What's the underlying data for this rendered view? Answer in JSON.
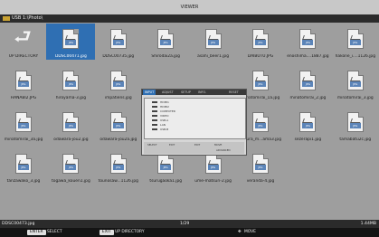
{
  "window": {
    "title": "VIEWER"
  },
  "path": {
    "text": "USB 1:\\Photo\\"
  },
  "files": [
    {
      "name": "UP DIRECTORY",
      "type": "updir"
    },
    {
      "name": "DDSC00471.jpg",
      "type": "image",
      "selected": true
    },
    {
      "name": "DDSC00735.jpg",
      "type": "image"
    },
    {
      "name": "Shirodai2a.jpg",
      "type": "image"
    },
    {
      "name": "asahi_beer1.jpg",
      "type": "image"
    },
    {
      "name": "DAIBUTU.JPG",
      "type": "image"
    },
    {
      "name": "enoshima....1887.jpg",
      "type": "image"
    },
    {
      "name": "hakone_i....1126.jpg",
      "type": "image"
    },
    {
      "name": "HANABI2.JPG",
      "type": "image"
    },
    {
      "name": "hiroyama-3.jpg",
      "type": "image"
    },
    {
      "name": "impatiens.jpg",
      "type": "image"
    },
    {
      "name": "",
      "type": "image",
      "hidden": true
    },
    {
      "name": "",
      "type": "image",
      "hidden": true
    },
    {
      "name": "minatomirai_1a.jpg",
      "type": "image"
    },
    {
      "name": "minatomirai_2.jpg",
      "type": "image"
    },
    {
      "name": "minatomirai_3.jpg",
      "type": "image"
    },
    {
      "name": "minatomirai_3a.jpg",
      "type": "image"
    },
    {
      "name": "odawara-jou2.jpg",
      "type": "image"
    },
    {
      "name": "odawara-jou2a.jpg",
      "type": "image"
    },
    {
      "name": "",
      "type": "image",
      "hidden": true
    },
    {
      "name": "",
      "type": "image",
      "hidden": true
    },
    {
      "name": "sakura_m...ama3.jpg",
      "type": "image"
    },
    {
      "name": "sezerapi1.jpg",
      "type": "image"
    },
    {
      "name": "tamabatu2c.jpg",
      "type": "image"
    },
    {
      "name": "tanzawako_3.jpg",
      "type": "image"
    },
    {
      "name": "togawa_kouen1.jpg",
      "type": "image"
    },
    {
      "name": "tounosaw...1126.jpg",
      "type": "image"
    },
    {
      "name": "tsurugaoka1.jpg",
      "type": "image"
    },
    {
      "name": "ume-matsuri-2.jpg",
      "type": "image"
    },
    {
      "name": "veranda-4.jpg",
      "type": "image"
    }
  ],
  "thumb_badge": "JPG",
  "menu": {
    "tabs": [
      "INPUT",
      "ADJUST",
      "SETUP",
      "INFO.",
      "RESET"
    ],
    "items": [
      "HDMI1",
      "HDMI2",
      "COMPUTER",
      "VIDEO",
      "USB-A",
      "LAN",
      "USB-B"
    ],
    "footer": [
      "SELECT",
      "EXIT",
      "EXIT",
      "MOVE",
      "ADVANCED"
    ]
  },
  "status": {
    "filename": "DDSC00473.jpg",
    "page": "1/29",
    "size": "1.44MB"
  },
  "help": {
    "enter_key": "ENTER",
    "enter_label": "SELECT",
    "exit_key": "EXIT",
    "exit_label": "UP DIRECTORY",
    "move_label": "MOVE"
  }
}
